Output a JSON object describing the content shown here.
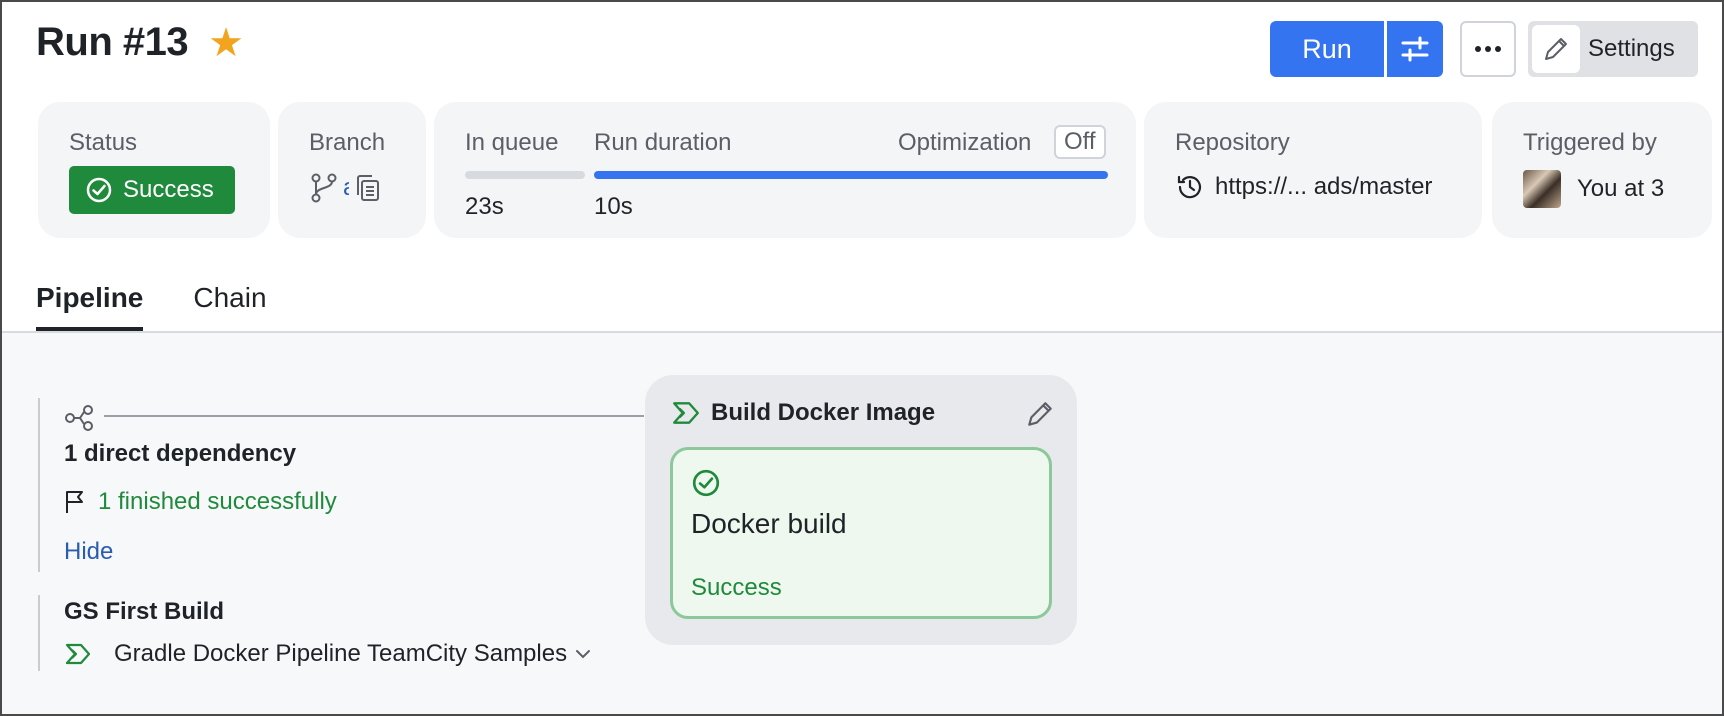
{
  "header": {
    "title": "Run #13",
    "run_label": "Run",
    "settings_label": "Settings"
  },
  "cards": {
    "status": {
      "label": "Status",
      "value": "Success"
    },
    "branch": {
      "label": "Branch",
      "value": "a"
    },
    "timing": {
      "in_queue_label": "In queue",
      "in_queue_value": "23s",
      "run_duration_label": "Run duration",
      "run_duration_value": "10s",
      "optimization_label": "Optimization",
      "optimization_value": "Off"
    },
    "repository": {
      "label": "Repository",
      "value": "https://... ads/master"
    },
    "triggered": {
      "label": "Triggered by",
      "value": "You at 3"
    }
  },
  "tabs": [
    {
      "label": "Pipeline",
      "active": true
    },
    {
      "label": "Chain",
      "active": false
    }
  ],
  "pipeline": {
    "dependency_title": "1 direct dependency",
    "dependency_status": "1 finished successfully",
    "hide_label": "Hide",
    "upstream_title": "GS First Build",
    "upstream_project": "Gradle Docker Pipeline TeamCity Samples",
    "stage": {
      "title": "Build Docker Image",
      "job_title": "Docker build",
      "job_status": "Success"
    }
  },
  "colors": {
    "accent": "#3574f0",
    "success": "#208a3c",
    "star": "#f2a41e",
    "link": "#2a5cb0"
  },
  "icons": [
    "star-icon",
    "tune-icon",
    "more-icon",
    "pencil-icon",
    "check-circle-icon",
    "branch-icon",
    "copy-icon",
    "history-icon",
    "dependency-icon",
    "flag-icon",
    "pipeline-icon",
    "chevron-down-icon"
  ]
}
